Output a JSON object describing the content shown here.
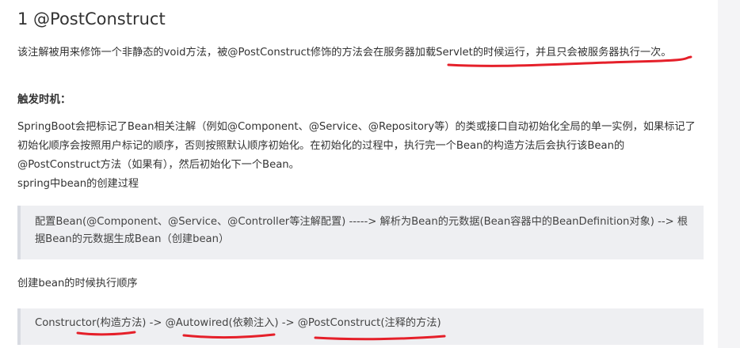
{
  "article": {
    "heading": "1 @PostConstruct",
    "intro": "该注解被用来修饰一个非静态的void方法，被@PostConstruct修饰的方法会在服务器加载Servlet的时候运行，并且只会被服务器执行一次。",
    "trigger_label": "触发时机：",
    "trigger_body": "SpringBoot会把标记了Bean相关注解（例如@Component、@Service、@Repository等）的类或接口自动初始化全局的单一实例，如果标记了初始化顺序会按照用户标记的顺序，否则按照默认顺序初始化。在初始化的过程中，执行完一个Bean的构造方法后会执行该Bean的@PostConstruct方法（如果有），然后初始化下一个Bean。",
    "process_label": "spring中bean的创建过程",
    "process_quote": "配置Bean(@Component、@Service、@Controller等注解配置) -----> 解析为Bean的元数据(Bean容器中的BeanDefinition对象) --> 根据Bean的元数据生成Bean（创建bean）",
    "order_label": "创建bean的时候执行顺序",
    "order_quote": "Constructor(构造方法) -> @Autowired(依赖注入) -> @PostConstruct(注释的方法)"
  },
  "annotation": {
    "color": "#e5202a"
  }
}
